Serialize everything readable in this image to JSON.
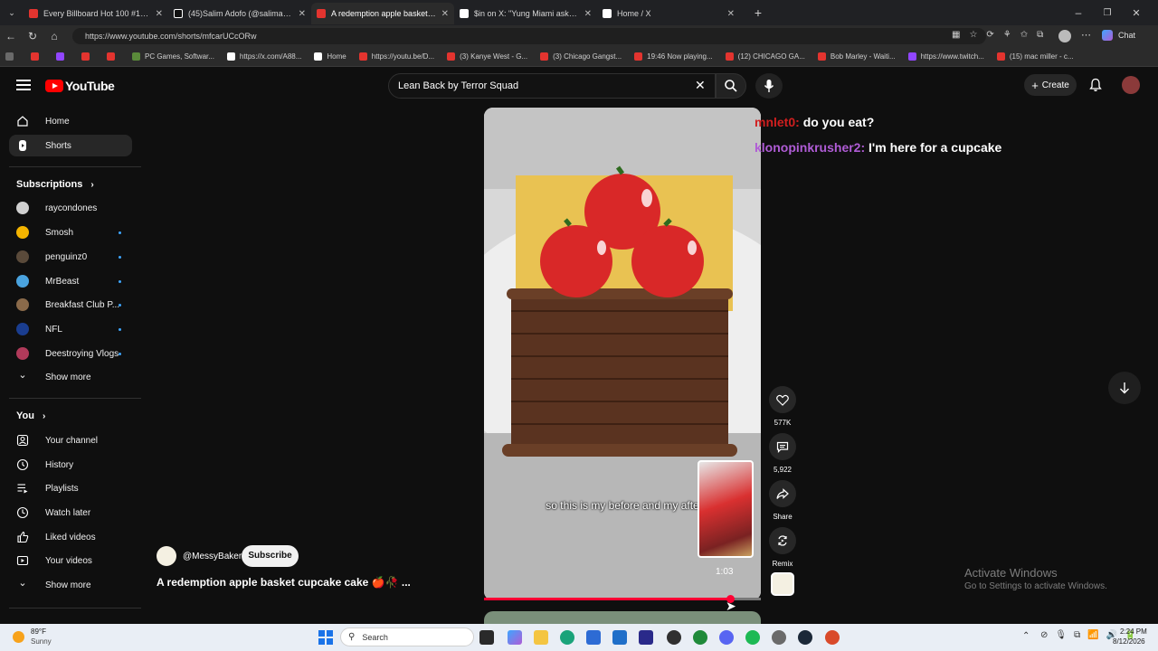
{
  "browser": {
    "tabs": [
      {
        "title": "Every Billboard Hot 100 #1 Single",
        "color": "#e3342f"
      },
      {
        "title": "(45)Salim Adofo (@salimadofo)'s ∨",
        "color": "#ffffff"
      },
      {
        "title": "A redemption apple basket cu",
        "color": "#e3342f",
        "active": true
      },
      {
        "title": "$in on X: \"Yung Miami asked Tyl",
        "color": "#ffffff"
      },
      {
        "title": "Home / X",
        "color": "#ffffff"
      }
    ],
    "url": "https://www.youtube.com/shorts/mfcarUCcORw",
    "chat_label": "Chat",
    "bookmarks": [
      "PC Games, Softwar...",
      "https://x.com/A88...",
      "Home",
      "https://youtu.be/D...",
      "(3) Kanye West - G...",
      "(3) Chicago Gangst...",
      "19:46 Now playing...",
      "(12) CHICAGO GA...",
      "Bob Marley - Waiti...",
      "https://www.twitch...",
      "(15) mac miller - c..."
    ]
  },
  "youtube": {
    "logo_text": "YouTube",
    "search_value": "Lean Back by Terror Squad",
    "create_label": "Create"
  },
  "sidebar": {
    "home": "Home",
    "shorts": "Shorts",
    "subscriptions_heading": "Subscriptions",
    "subscriptions": [
      {
        "name": "raycondones",
        "color": "#d0d0d0",
        "dot": false
      },
      {
        "name": "Smosh",
        "color": "#f4b400",
        "dot": true
      },
      {
        "name": "penguinz0",
        "color": "#5a4a3a",
        "dot": true
      },
      {
        "name": "MrBeast",
        "color": "#4aa3df",
        "dot": true
      },
      {
        "name": "Breakfast Club P...",
        "color": "#8a6a4a",
        "dot": true
      },
      {
        "name": "NFL",
        "color": "#1a3d8f",
        "dot": true
      },
      {
        "name": "Deestroying Vlogs",
        "color": "#b03a5a",
        "dot": true
      }
    ],
    "show_more": "Show more",
    "you_heading": "You",
    "you_items": [
      "Your channel",
      "History",
      "Playlists",
      "Watch later",
      "Liked videos",
      "Your videos"
    ],
    "show_more_2": "Show more"
  },
  "video": {
    "channel": "@MessyBaker",
    "subscribe": "Subscribe",
    "title": "A redemption apple basket cupcake cake 🍎🥀 ...",
    "caption": "so this is my before and my after",
    "inset_duration": "1:03",
    "likes": "577K",
    "comments": "5,922",
    "share": "Share",
    "remix": "Remix",
    "progress_fraction": 0.89
  },
  "chat_overlay": [
    {
      "user": "mnlet0:",
      "user_color": "#d11f1f",
      "message": "do you eat?"
    },
    {
      "user": "klonopinkrusher2:",
      "user_color": "#b05cd6",
      "message": "I'm here for a cupcake"
    }
  ],
  "watermark": {
    "line1": "Activate Windows",
    "line2": "Go to Settings to activate Windows."
  },
  "taskbar": {
    "weather_temp": "89°F",
    "weather_desc": "Sunny",
    "search_label": "Search",
    "time": "2:24 PM",
    "date": "8/12/2026"
  }
}
